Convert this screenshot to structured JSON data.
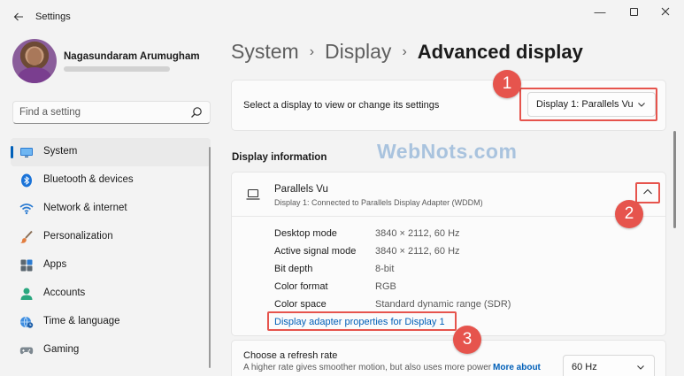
{
  "window": {
    "title": "Settings",
    "controls": {
      "minimize": "—"
    }
  },
  "user": {
    "name": "Nagasundaram Arumugham"
  },
  "search": {
    "placeholder": "Find a setting"
  },
  "sidebar": {
    "items": [
      {
        "label": "System",
        "icon": "monitor-icon",
        "active": true
      },
      {
        "label": "Bluetooth & devices",
        "icon": "bluetooth-icon"
      },
      {
        "label": "Network & internet",
        "icon": "wifi-icon"
      },
      {
        "label": "Personalization",
        "icon": "brush-icon"
      },
      {
        "label": "Apps",
        "icon": "apps-icon"
      },
      {
        "label": "Accounts",
        "icon": "person-icon"
      },
      {
        "label": "Time & language",
        "icon": "globe-clock-icon"
      },
      {
        "label": "Gaming",
        "icon": "gamepad-icon"
      }
    ]
  },
  "breadcrumb": {
    "items": [
      "System",
      "Display"
    ],
    "separator": "›",
    "current": "Advanced display"
  },
  "display_select": {
    "label": "Select a display to view or change its settings",
    "selected": "Display 1: Parallels Vu"
  },
  "display_info": {
    "section_title": "Display information",
    "name": "Parallels Vu",
    "subtitle": "Display 1: Connected to Parallels Display Adapter (WDDM)",
    "rows": [
      {
        "label": "Desktop mode",
        "value": "3840 × 2112, 60 Hz"
      },
      {
        "label": "Active signal mode",
        "value": "3840 × 2112, 60 Hz"
      },
      {
        "label": "Bit depth",
        "value": "8-bit"
      },
      {
        "label": "Color format",
        "value": "RGB"
      },
      {
        "label": "Color space",
        "value": "Standard dynamic range (SDR)"
      }
    ],
    "adapter_link": "Display adapter properties for Display 1"
  },
  "refresh": {
    "title": "Choose a refresh rate",
    "subtitle": "A higher rate gives smoother motion, but also uses more power",
    "learn_more": "More about",
    "selected": "60 Hz"
  },
  "annotations": {
    "badges": [
      "1",
      "2",
      "3"
    ],
    "color": "#e6544d"
  },
  "watermark": "WebNots.com",
  "colors": {
    "accent": "#005fb8",
    "background": "#f3f3f3",
    "card": "#fbfbfb"
  }
}
